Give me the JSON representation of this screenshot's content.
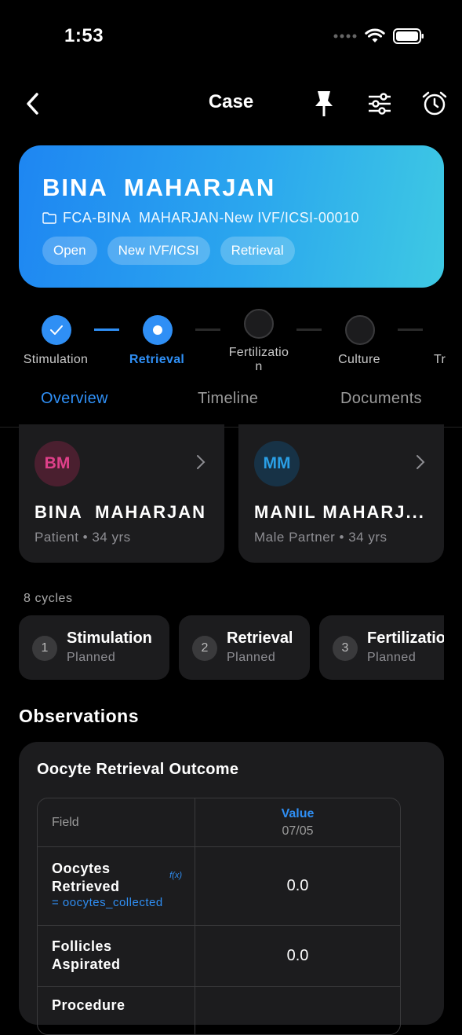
{
  "status": {
    "time": "1:53"
  },
  "nav": {
    "title": "Case",
    "icons": [
      "back-chevron-icon",
      "pin-icon",
      "filter-sliders-icon",
      "alarm-clock-icon"
    ]
  },
  "banner": {
    "name": "BINA  MAHARJAN",
    "case_id": "FCA-BINA  MAHARJAN-New IVF/ICSI-00010",
    "chips": [
      "Open",
      "New IVF/ICSI",
      "Retrieval"
    ],
    "gradient": [
      "#1e86f2",
      "#3ec9e3"
    ]
  },
  "stepper": {
    "steps": [
      {
        "label": "Stimulation",
        "state": "done"
      },
      {
        "label": "Retrieval",
        "state": "current"
      },
      {
        "label": "Fertilizatio\nn",
        "state": "pending"
      },
      {
        "label": "Culture",
        "state": "pending"
      },
      {
        "label": "Tr",
        "state": "pending"
      }
    ]
  },
  "tabs": [
    {
      "label": "Overview",
      "active": true
    },
    {
      "label": "Timeline",
      "active": false
    },
    {
      "label": "Documents",
      "active": false
    }
  ],
  "members": [
    {
      "initials": "BM",
      "name": "BINA  MAHARJAN",
      "subtitle": "Patient • 34 yrs",
      "accent": "#e0408a"
    },
    {
      "initials": "MM",
      "name": "MANIL MAHARJ...",
      "subtitle": "Male Partner • 34 yrs",
      "accent": "#2a9fe6"
    }
  ],
  "cycles": {
    "count_label": "8 cycles",
    "items": [
      {
        "num": "1",
        "title": "Stimulation",
        "status": "Planned"
      },
      {
        "num": "2",
        "title": "Retrieval",
        "status": "Planned"
      },
      {
        "num": "3",
        "title": "Fertilization",
        "status": "Planned"
      }
    ]
  },
  "observations": {
    "heading": "Observations",
    "card_title": "Oocyte Retrieval Outcome",
    "table": {
      "field_header": "Field",
      "value_header": "Value",
      "date": "07/05",
      "rows": [
        {
          "label": "Oocytes Retrieved",
          "formula": "= oocytes_collected",
          "fx": "f(x)",
          "value": "0.0"
        },
        {
          "label": "Follicles Aspirated",
          "value": "0.0"
        },
        {
          "label": "Procedure",
          "value": ""
        }
      ]
    }
  }
}
